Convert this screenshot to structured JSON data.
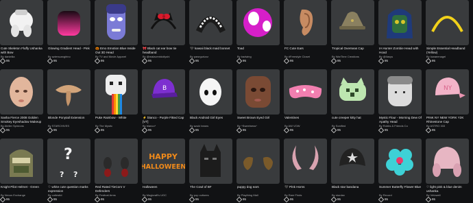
{
  "items": [
    {
      "name": "Cute Skeleton Fluffy Ushanka with Bow",
      "creator": "By daniellia",
      "price": "95",
      "icon": "white-fluffy-hat-icon"
    },
    {
      "name": "Glowing Gradient Head - Pink",
      "creator": "By azierscangirino",
      "price": "95",
      "icon": "pink-gradient-head-icon"
    },
    {
      "name": "🎃 Emo Emotion Blue Inside Out 3D Head",
      "creator": "By TV and Movie Apparel",
      "price": "95",
      "icon": "purple-head-icon"
    },
    {
      "name": "🎀 Black cat ear bow tie headband",
      "creator": "By @malaventdollyshi",
      "price": "95",
      "icon": "cat-ear-headband-icon"
    },
    {
      "name": "🖤 kawaii black maid bonnet",
      "creator": "By pawrgurlzzz",
      "price": "95",
      "icon": "maid-bonnet-icon"
    },
    {
      "name": "Toad",
      "creator": "By badwing",
      "price": "95",
      "icon": "toad-head-icon"
    },
    {
      "name": "FC Cute Ears",
      "creator": "By #Freestyle Closet",
      "price": "95",
      "icon": "ear-icon"
    },
    {
      "name": "Tropical Overseas Cap",
      "creator": "By WarTime Creations",
      "price": "95",
      "icon": "army-cap-icon"
    },
    {
      "name": "IA Hunter Zombie Head with Hood",
      "creator": "By @iIasys",
      "price": "95",
      "icon": "zombie-hood-icon"
    },
    {
      "name": "Simple Essential Headband (Yellow)",
      "creator": "By lowaeenagel",
      "price": "95",
      "icon": "yellow-headband-icon"
    },
    {
      "name": "Sasha Fierce 2008 Golden Smokey Eyeshadow Makeup",
      "creator": "By Atelier Spinrons",
      "price": "95",
      "icon": "bald-head-icon"
    },
    {
      "name": "Blonde Ponytail Extension",
      "creator": "By STARCHIVES",
      "price": "95",
      "icon": "blonde-ponytail-icon"
    },
    {
      "name": "Puke Rainbow - White",
      "creator": "By The Mystic",
      "price": "95",
      "icon": "rainbow-puke-icon"
    },
    {
      "name": "⚡ blanco - Purple Fitted Cap [VT]",
      "creator": "By blanco*",
      "price": "95",
      "icon": "purple-cap-icon"
    },
    {
      "name": "Black Android Girl Eyes",
      "creator": "By azuki beans",
      "price": "95",
      "icon": "android-eyes-icon"
    },
    {
      "name": "Sweet Brown Eyed Girl",
      "creator": "By ^Sweetness^",
      "price": "95",
      "icon": "brown-face-icon"
    },
    {
      "name": "Valentines",
      "creator": "By AW VOW",
      "price": "95",
      "icon": "sleep-mask-icon"
    },
    {
      "name": "cute creeper kitty hat",
      "creator": "By Sonified",
      "price": "95",
      "icon": "creeper-hat-icon"
    },
    {
      "name": "Mystic Flour - Morning Dew Of Apathy Head",
      "creator": "By Robbs & Friends Co",
      "price": "95",
      "icon": "gray-head-icon"
    },
    {
      "name": "PINK NY NEW YORK Y2K Rhinestone Cap",
      "creator": "By ASTRO 333",
      "price": "95",
      "icon": "pink-ny-cap-icon"
    },
    {
      "name": "Knight Pilot Helmet - Green",
      "creator": "By Nexus Exchange",
      "price": "95",
      "icon": "knight-helmet-icon"
    },
    {
      "name": "♡ white cute question marks expression",
      "creator": "By cutiestid",
      "price": "95",
      "icon": "question-marks-icon"
    },
    {
      "name": "Red Rated TieCom V Defenders",
      "creator": "By Festival Arms",
      "price": "95",
      "icon": "red-earmuffs-icon"
    },
    {
      "name": "Halloween",
      "creator": "By Magicraft's UGC",
      "price": "95",
      "icon": "halloween-text-icon"
    },
    {
      "name": "The Cowl of BF",
      "creator": "By pop cultures",
      "price": "95",
      "icon": "batman-cowl-icon"
    },
    {
      "name": "puppy dog ears",
      "creator": "By Plaything Mall",
      "price": "95",
      "icon": "puppy-ears-icon"
    },
    {
      "name": "🖤 Pink Horns",
      "creator": "By Rare Finds",
      "price": "95",
      "icon": "pink-horns-icon"
    },
    {
      "name": "Black star bandana",
      "creator": "By sturdax",
      "price": "95",
      "icon": "star-bandana-icon"
    },
    {
      "name": "Summer Butterfly Flower Blue",
      "creator": "By Record",
      "price": "95",
      "icon": "blue-flower-icon"
    },
    {
      "name": "♡ light pink & blue denim ushanka",
      "creator": "By Velowell",
      "price": "95",
      "icon": "pink-ushanka-icon"
    }
  ]
}
